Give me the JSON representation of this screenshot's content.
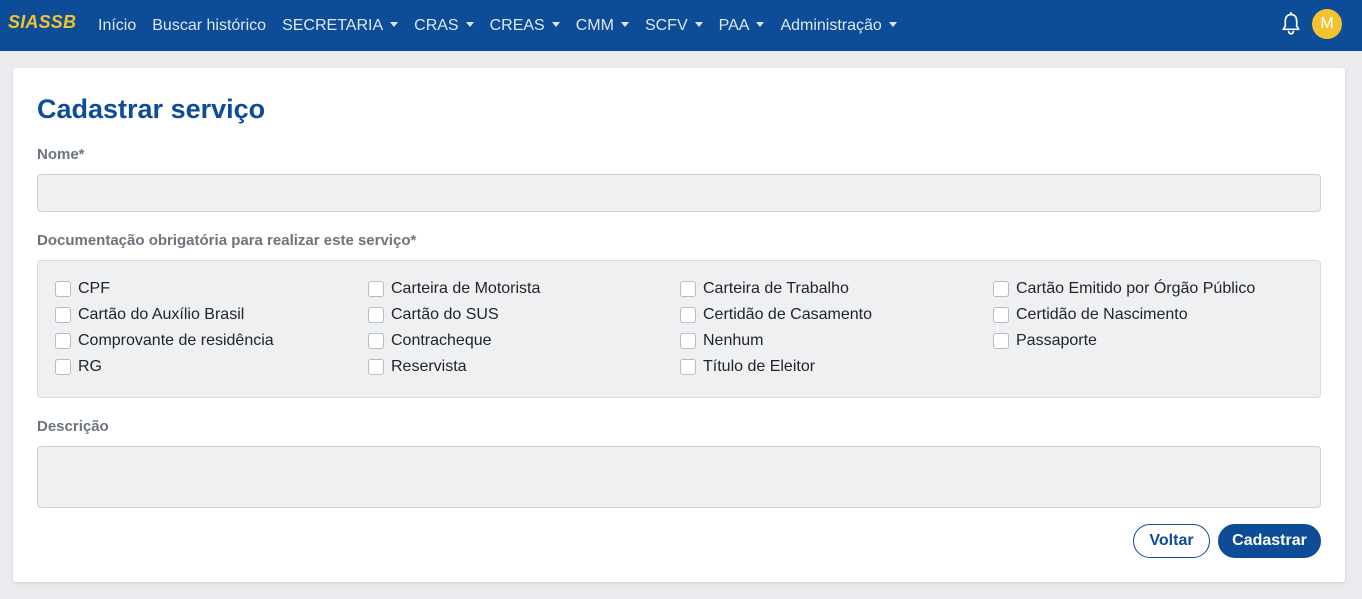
{
  "app": {
    "brand": "SIASSB"
  },
  "nav": {
    "items": [
      {
        "label": "Início",
        "dropdown": false
      },
      {
        "label": "Buscar histórico",
        "dropdown": false
      },
      {
        "label": "SECRETARIA",
        "dropdown": true
      },
      {
        "label": "CRAS",
        "dropdown": true
      },
      {
        "label": "CREAS",
        "dropdown": true
      },
      {
        "label": "CMM",
        "dropdown": true
      },
      {
        "label": "SCFV",
        "dropdown": true
      },
      {
        "label": "PAA",
        "dropdown": true
      },
      {
        "label": "Administração",
        "dropdown": true
      }
    ],
    "notifications_icon": "bell-icon",
    "avatar_initial": "M"
  },
  "form": {
    "title": "Cadastrar serviço",
    "name_label": "Nome*",
    "name_value": "",
    "docs_label": "Documentação obrigatória para realizar este serviço*",
    "documents": [
      {
        "label": "CPF",
        "checked": false
      },
      {
        "label": "Carteira de Motorista",
        "checked": false
      },
      {
        "label": "Carteira de Trabalho",
        "checked": false
      },
      {
        "label": "Cartão Emitido por Órgão Público",
        "checked": false
      },
      {
        "label": "Cartão do Auxílio Brasil",
        "checked": false
      },
      {
        "label": "Cartão do SUS",
        "checked": false
      },
      {
        "label": "Certidão de Casamento",
        "checked": false
      },
      {
        "label": "Certidão de Nascimento",
        "checked": false
      },
      {
        "label": "Comprovante de residência",
        "checked": false
      },
      {
        "label": "Contracheque",
        "checked": false
      },
      {
        "label": "Nenhum",
        "checked": false
      },
      {
        "label": "Passaporte",
        "checked": false
      },
      {
        "label": "RG",
        "checked": false
      },
      {
        "label": "Reservista",
        "checked": false
      },
      {
        "label": "Título de Eleitor",
        "checked": false
      }
    ],
    "description_label": "Descrição",
    "description_value": "",
    "back_label": "Voltar",
    "submit_label": "Cadastrar"
  },
  "colors": {
    "primary": "#0d4c97",
    "accent": "#f2c230",
    "background": "#e9ebee",
    "field": "#eef0f2"
  }
}
